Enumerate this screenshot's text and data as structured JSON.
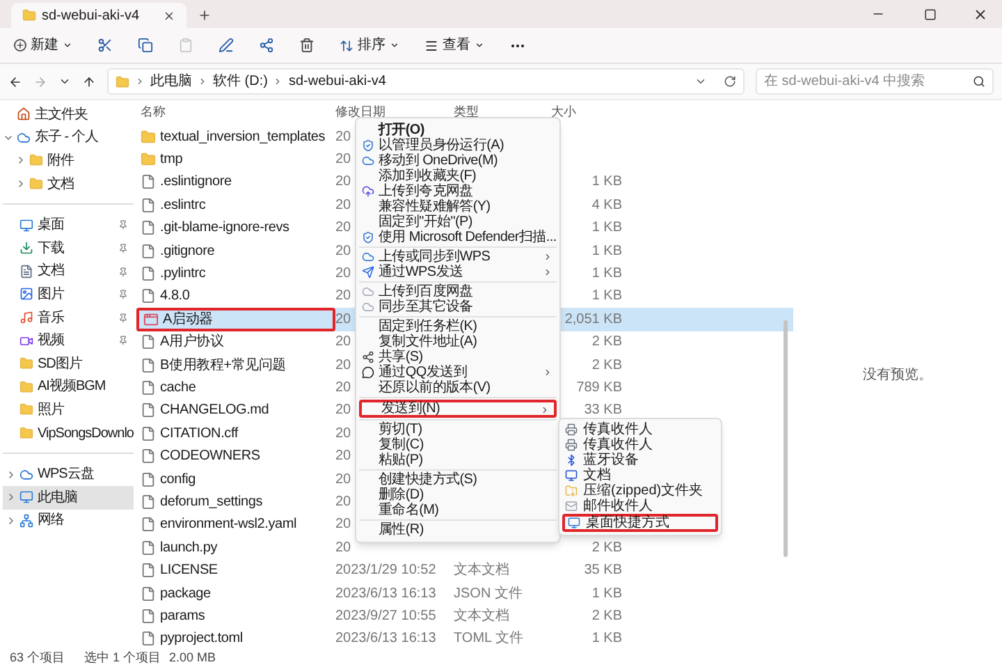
{
  "window": {
    "tab_title": "sd-webui-aki-v4"
  },
  "toolbar": {
    "new_label": "新建",
    "sort_label": "排序",
    "view_label": "查看"
  },
  "address": {
    "crumbs": [
      "此电脑",
      "软件 (D:)",
      "sd-webui-aki-v4"
    ]
  },
  "search": {
    "placeholder": "在 sd-webui-aki-v4 中搜索"
  },
  "sidebar": {
    "groups": [
      [
        {
          "label": "主文件夹",
          "pinned": false,
          "selected": false
        },
        {
          "label": "东子 - 个人",
          "pinned": false,
          "selected": false,
          "expanded": true,
          "children": [
            {
              "label": "附件",
              "pinned": false,
              "selected": false,
              "expanded": false
            },
            {
              "label": "文档",
              "pinned": false,
              "selected": false,
              "expanded": false
            }
          ]
        }
      ],
      [
        {
          "label": "桌面",
          "pinned": true,
          "selected": false
        },
        {
          "label": "下载",
          "pinned": true,
          "selected": false
        },
        {
          "label": "文档",
          "pinned": true,
          "selected": false
        },
        {
          "label": "图片",
          "pinned": true,
          "selected": false
        },
        {
          "label": "音乐",
          "pinned": true,
          "selected": false
        },
        {
          "label": "视频",
          "pinned": true,
          "selected": false
        },
        {
          "label": "SD图片",
          "pinned": false,
          "selected": false
        },
        {
          "label": "AI视频BGM",
          "pinned": false,
          "selected": false
        },
        {
          "label": "照片",
          "pinned": false,
          "selected": false
        },
        {
          "label": "VipSongsDownlo",
          "pinned": false,
          "selected": false
        }
      ],
      [
        {
          "label": "WPS云盘",
          "pinned": false,
          "selected": false,
          "expanded": false
        },
        {
          "label": "此电脑",
          "pinned": false,
          "selected": true,
          "expanded": false
        },
        {
          "label": "网络",
          "pinned": false,
          "selected": false,
          "expanded": false
        }
      ]
    ]
  },
  "table": {
    "columns": [
      "名称",
      "修改日期",
      "类型",
      "大小"
    ],
    "rows": [
      {
        "kind": "folder",
        "name": "textual_inversion_templates",
        "date": "20",
        "selected": false,
        "highlighted": false
      },
      {
        "kind": "folder",
        "name": "tmp",
        "date": "20",
        "selected": false,
        "highlighted": false
      },
      {
        "kind": "file",
        "name": ".eslintignore",
        "date": "20",
        "size": "1 KB",
        "selected": false,
        "highlighted": false
      },
      {
        "kind": "file",
        "name": ".eslintrc",
        "date": "20",
        "size": "4 KB",
        "selected": false,
        "highlighted": false
      },
      {
        "kind": "file",
        "name": ".git-blame-ignore-revs",
        "date": "20",
        "size": "1 KB",
        "selected": false,
        "highlighted": false
      },
      {
        "kind": "file",
        "name": ".gitignore",
        "date": "20",
        "size": "1 KB",
        "selected": false,
        "highlighted": false
      },
      {
        "kind": "file",
        "name": ".pylintrc",
        "date": "20",
        "size": "1 KB",
        "selected": false,
        "highlighted": false
      },
      {
        "kind": "file",
        "name": "4.8.0",
        "date": "20",
        "size": "1 KB",
        "selected": false,
        "highlighted": false
      },
      {
        "kind": "app",
        "name": "A启动器",
        "date": "20",
        "size": "2,051 KB",
        "selected": true,
        "highlighted": true
      },
      {
        "kind": "file",
        "name": "A用户协议",
        "date": "20",
        "size": "2 KB",
        "selected": false,
        "highlighted": false
      },
      {
        "kind": "file",
        "name": "B使用教程+常见问题",
        "date": "20",
        "size": "2 KB",
        "selected": false,
        "highlighted": false
      },
      {
        "kind": "file",
        "name": "cache",
        "date": "20",
        "size": "789 KB",
        "selected": false,
        "highlighted": false
      },
      {
        "kind": "file",
        "name": "CHANGELOG.md",
        "date": "20",
        "size": "33 KB",
        "selected": false,
        "highlighted": false
      },
      {
        "kind": "file",
        "name": "CITATION.cff",
        "date": "20",
        "selected": false,
        "highlighted": false
      },
      {
        "kind": "file",
        "name": "CODEOWNERS",
        "date": "20",
        "selected": false,
        "highlighted": false
      },
      {
        "kind": "file",
        "name": "config",
        "date": "20",
        "selected": false,
        "highlighted": false
      },
      {
        "kind": "file",
        "name": "deforum_settings",
        "date": "20",
        "selected": false,
        "highlighted": false
      },
      {
        "kind": "file",
        "name": "environment-wsl2.yaml",
        "date": "20",
        "selected": false,
        "highlighted": false
      },
      {
        "kind": "file",
        "name": "launch.py",
        "date": "20",
        "size": "2 KB",
        "selected": false,
        "highlighted": false
      },
      {
        "kind": "file",
        "name": "LICENSE",
        "date": "2023/1/29 10:52",
        "type": "文本文档",
        "size": "35 KB",
        "selected": false,
        "highlighted": false
      },
      {
        "kind": "file",
        "name": "package",
        "date": "2023/6/13 16:13",
        "type": "JSON 文件",
        "size": "1 KB",
        "selected": false,
        "highlighted": false
      },
      {
        "kind": "file",
        "name": "params",
        "date": "2023/9/27 10:55",
        "type": "文本文档",
        "size": "2 KB",
        "selected": false,
        "highlighted": false
      },
      {
        "kind": "file",
        "name": "pyproject.toml",
        "date": "2023/6/13 16:13",
        "type": "TOML 文件",
        "size": "1 KB",
        "selected": false,
        "highlighted": false
      }
    ]
  },
  "context_menu": {
    "groups": [
      [
        {
          "label": "打开(O)",
          "bold": true,
          "submenu": false,
          "highlighted": false
        },
        {
          "label": "以管理员身份运行(A)",
          "bold": false,
          "submenu": false,
          "highlighted": false
        },
        {
          "label": "移动到 OneDrive(M)",
          "bold": false,
          "submenu": false,
          "highlighted": false
        },
        {
          "label": "添加到收藏夹(F)",
          "bold": false,
          "submenu": false,
          "highlighted": false
        },
        {
          "label": "上传到夸克网盘",
          "bold": false,
          "submenu": false,
          "highlighted": false
        },
        {
          "label": "兼容性疑难解答(Y)",
          "bold": false,
          "submenu": false,
          "highlighted": false
        },
        {
          "label": "固定到\"开始\"(P)",
          "bold": false,
          "submenu": false,
          "highlighted": false
        },
        {
          "label": "使用 Microsoft Defender扫描...",
          "bold": false,
          "submenu": false,
          "highlighted": false
        }
      ],
      [
        {
          "label": "上传或同步到WPS",
          "bold": false,
          "submenu": true,
          "highlighted": false
        },
        {
          "label": "通过WPS发送",
          "bold": false,
          "submenu": true,
          "highlighted": false
        }
      ],
      [
        {
          "label": "上传到百度网盘",
          "bold": false,
          "submenu": false,
          "highlighted": false
        },
        {
          "label": "同步至其它设备",
          "bold": false,
          "submenu": false,
          "highlighted": false
        }
      ],
      [
        {
          "label": "固定到任务栏(K)",
          "bold": false,
          "submenu": false,
          "highlighted": false
        },
        {
          "label": "复制文件地址(A)",
          "bold": false,
          "submenu": false,
          "highlighted": false
        },
        {
          "label": "共享(S)",
          "bold": false,
          "submenu": false,
          "highlighted": false
        },
        {
          "label": "通过QQ发送到",
          "bold": false,
          "submenu": true,
          "highlighted": false
        },
        {
          "label": "还原以前的版本(V)",
          "bold": false,
          "submenu": false,
          "highlighted": false
        }
      ],
      [
        {
          "label": "发送到(N)",
          "bold": false,
          "submenu": true,
          "highlighted": true
        }
      ],
      [
        {
          "label": "剪切(T)",
          "bold": false,
          "submenu": false,
          "highlighted": false
        },
        {
          "label": "复制(C)",
          "bold": false,
          "submenu": false,
          "highlighted": false
        },
        {
          "label": "粘贴(P)",
          "bold": false,
          "submenu": false,
          "highlighted": false
        }
      ],
      [
        {
          "label": "创建快捷方式(S)",
          "bold": false,
          "submenu": false,
          "highlighted": false
        },
        {
          "label": "删除(D)",
          "bold": false,
          "submenu": false,
          "highlighted": false
        },
        {
          "label": "重命名(M)",
          "bold": false,
          "submenu": false,
          "highlighted": false
        }
      ],
      [
        {
          "label": "属性(R)",
          "bold": false,
          "submenu": false,
          "highlighted": false
        }
      ]
    ]
  },
  "send_to_menu": {
    "items": [
      {
        "label": "传真收件人",
        "highlighted": false
      },
      {
        "label": "传真收件人",
        "highlighted": false
      },
      {
        "label": "蓝牙设备",
        "highlighted": false
      },
      {
        "label": "文档",
        "highlighted": false
      },
      {
        "label": "压缩(zipped)文件夹",
        "highlighted": false
      },
      {
        "label": "邮件收件人",
        "highlighted": false
      },
      {
        "label": "桌面快捷方式",
        "highlighted": true
      }
    ]
  },
  "preview": {
    "message": "没有预览。"
  },
  "status_bar": {
    "count": "63 个项目",
    "selection": "选中 1 个项目",
    "size": "2.00 MB"
  }
}
